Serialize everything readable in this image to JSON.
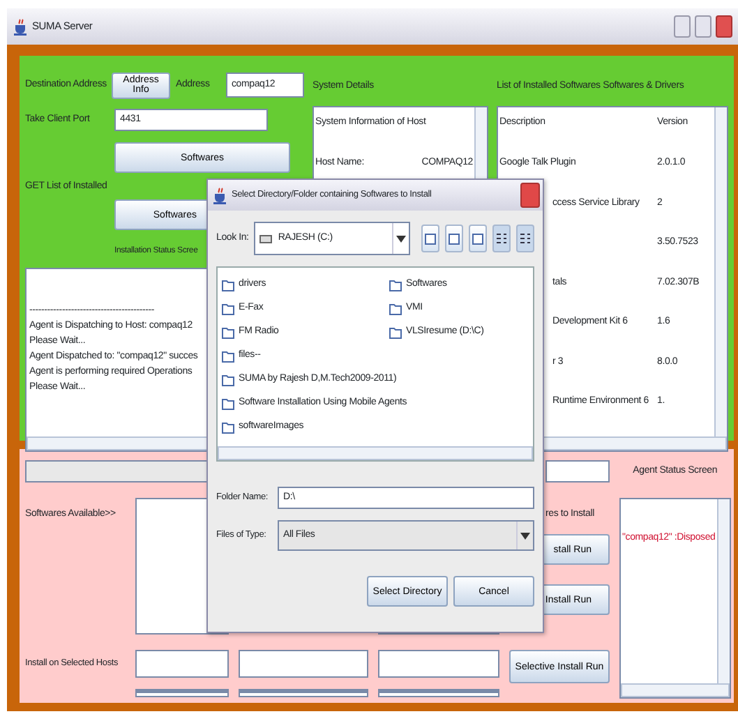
{
  "window": {
    "title": "SUMA Server"
  },
  "destination": {
    "label": "Destination Address",
    "button": "Address Info",
    "address_label": "Address",
    "address": "compaq12"
  },
  "port": {
    "label": "Take Client Port",
    "value": "4431"
  },
  "softwares_button": "Softwares",
  "installed_label": "GET List of Installed",
  "softwares_button_2": "Softwares",
  "status_label": "Installation Status Scree",
  "log": [
    "------------------------------------------",
    "Agent is Dispatching to Host: compaq12",
    "Please Wait...",
    "Agent Dispatched to: \"compaq12\" succes",
    "Agent is performing required Operations",
    "Please Wait..."
  ],
  "system_details": {
    "title": "System Details",
    "rows": [
      {
        "label": "System Information of Host"
      },
      {
        "label": "Host Name:",
        "value": "COMPAQ12"
      }
    ]
  },
  "installed": {
    "title": "List of Installed Softwares Softwares & Drivers",
    "columns": [
      "Description",
      "Version"
    ],
    "rows": [
      {
        "kind": "full",
        "description": "Google Talk Plugin",
        "version": "2.0.1.0"
      },
      {
        "kind": "cut",
        "description": "ccess Service Library",
        "version": "2"
      },
      {
        "kind": "cut",
        "version": "3.50.7523"
      },
      {
        "kind": "cut",
        "description": "tals",
        "version": "7.02.307B"
      },
      {
        "kind": "cut",
        "description": "Development Kit 6",
        "version": "1.6"
      },
      {
        "kind": "cut",
        "description": "r 3",
        "version": "8.0.0"
      },
      {
        "kind": "cut",
        "description": "Runtime Environment 6",
        "version": "1."
      }
    ]
  },
  "agent_status": {
    "title": "Agent Status Screen",
    "text": "\"compaq12\" :Disposed"
  },
  "available_label": "Softwares Available>>",
  "install_label": "res to Install",
  "install_buttons": [
    "stall Run",
    "Install Run"
  ],
  "selected_hosts_label": "Install on Selected Hosts",
  "selective_button": "Selective Install Run",
  "dialog": {
    "title": "Select Directory/Folder containing Softwares to Install",
    "look_in_label": "Look In:",
    "look_in": "RAJESH (C:)",
    "files": [
      "drivers",
      "E-Fax",
      "FM Radio",
      "files--",
      "SUMA by Rajesh D,M.Tech2009-2011)",
      "Software Installation Using Mobile Agents",
      "softwareImages",
      "Softwares",
      "VMI",
      "VLSIresume (D:\\C)"
    ],
    "folder_name_label": "Folder Name:",
    "folder_name": "D:\\",
    "type_label": "Files of Type:",
    "type": "All Files",
    "buttons": [
      "Select Directory",
      "Cancel"
    ]
  }
}
